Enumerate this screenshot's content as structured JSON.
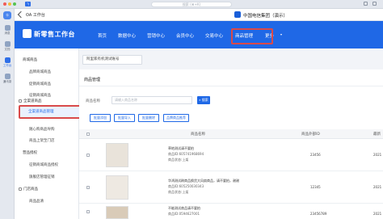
{
  "window": {
    "app_badge": "飞",
    "search_placeholder": "搜索 (⌘+K)"
  },
  "rail": {
    "avatar": "卡",
    "items": [
      {
        "label": "消息",
        "icon": "chat-icon"
      },
      {
        "label": "文档",
        "icon": "doc-icon"
      },
      {
        "label": "工作台",
        "icon": "workbench-icon",
        "active": true
      },
      {
        "label": "通讯录",
        "icon": "contacts-icon"
      }
    ]
  },
  "chat": {
    "title": "OA 工作台",
    "org_name": "中国电信集团（演示）"
  },
  "portal": {
    "title": "新零售工作台",
    "nav": [
      "首页",
      "数据中心",
      "营销中心",
      "会员中心",
      "交易中心",
      "商品管理",
      "更多"
    ],
    "active_nav": "商品管理"
  },
  "sidenav": {
    "items": [
      {
        "label": "商城商品",
        "type": "group"
      },
      {
        "label": "品牌商城商品",
        "type": "sub"
      },
      {
        "label": "促销商城商品",
        "type": "sub"
      },
      {
        "label": "征销商城商品",
        "type": "sub"
      },
      {
        "label": "全渠道商品",
        "type": "group"
      },
      {
        "label": "全渠道商品管理",
        "type": "active"
      },
      {
        "label": "随心购商品导购",
        "type": "sub"
      },
      {
        "label": "商品上架至门店",
        "type": "sub"
      },
      {
        "label": "营品授权",
        "type": "group"
      },
      {
        "label": "征销商城商品授权",
        "type": "sub"
      },
      {
        "label": "旗舰店管理征销",
        "type": "sub"
      },
      {
        "label": "门店商品",
        "type": "group"
      },
      {
        "label": "商品品清",
        "type": "sub"
      }
    ]
  },
  "content": {
    "subtab": "阿里家有机测试账号",
    "panel_title": "商品管理",
    "filter_label": "商品名称",
    "filter_placeholder": "请输入商品名称",
    "search_button": "搜索",
    "actions": [
      "批量添加",
      "批量导入",
      "批量删除",
      "品牌商品推荐"
    ],
    "columns": [
      "商品名称",
      "商品外部ID",
      "最新"
    ],
    "rows": [
      {
        "name": "草地测试请不要拍",
        "id": "商品ID:605741968694",
        "status": "商品状态:上架",
        "code": "23456",
        "time": "2021"
      },
      {
        "name": "华鸿测试刷商品换货大风扇商品，请不要拍，谢谢",
        "id": "商品ID:605250030343",
        "status": "商品状态:上架",
        "code": "12345",
        "time": "2021"
      },
      {
        "name": "不能测试商品请不要拍",
        "id": "商品ID:0594627001",
        "status": "",
        "code": "23456789",
        "time": "2021"
      }
    ]
  }
}
